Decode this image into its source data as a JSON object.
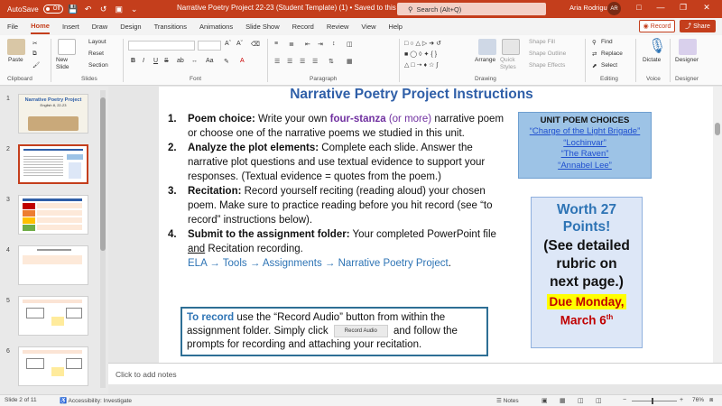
{
  "titlebar": {
    "autosave_label": "AutoSave",
    "autosave_state": "Off",
    "doc_title": "Narrative Poetry Project 22-23 (Student Template) (1) • Saved to this PC",
    "search_placeholder": "Search (Alt+Q)",
    "user_name": "Aria Rodriguez",
    "user_initials": "AR"
  },
  "ribbon_tabs": [
    "File",
    "Home",
    "Insert",
    "Draw",
    "Design",
    "Transitions",
    "Animations",
    "Slide Show",
    "Record",
    "Review",
    "View",
    "Help"
  ],
  "ribbon_actions": {
    "record": "Record",
    "share": "Share"
  },
  "ribbon": {
    "clipboard": {
      "paste": "Paste",
      "label": "Clipboard"
    },
    "slides": {
      "new_slide": "New Slide",
      "layout": "Layout",
      "reset": "Reset",
      "section": "Section",
      "label": "Slides"
    },
    "font": {
      "label": "Font",
      "bold": "B",
      "italic": "I",
      "underline": "U",
      "strike": "S"
    },
    "paragraph": {
      "label": "Paragraph"
    },
    "drawing": {
      "arrange": "Arrange",
      "quick_styles": "Quick Styles",
      "shape_fill": "Shape Fill",
      "shape_outline": "Shape Outline",
      "shape_effects": "Shape Effects",
      "label": "Drawing"
    },
    "editing": {
      "find": "Find",
      "replace": "Replace",
      "select": "Select",
      "label": "Editing"
    },
    "voice": {
      "dictate": "Dictate",
      "label": "Voice"
    },
    "designer": {
      "designer": "Designer",
      "label": "Designer"
    }
  },
  "thumbnails": {
    "numbers": [
      "1",
      "2",
      "3",
      "4",
      "5",
      "6"
    ],
    "slide1_title": "Narrative Poetry Project",
    "slide1_subtitle": "English 8, 22-23"
  },
  "slide": {
    "title": "Narrative Poetry Project Instructions",
    "items": [
      {
        "num": "1.",
        "label": "Poem choice:",
        "t1": " Write your own ",
        "highlight": "four-stanza",
        "highlight2": " (or more)",
        "t2": " narrative poem or choose one of the narrative poems we studied in this unit."
      },
      {
        "num": "2.",
        "label": "Analyze the plot elements:",
        "text": " Complete each slide. Answer the narrative plot questions and use textual evidence to support your responses. (Textual evidence = quotes from the poem.)"
      },
      {
        "num": "3.",
        "label": "Recitation:",
        "text": " Record yourself reciting (reading aloud) your chosen poem. Make sure to practice reading before you hit record (see “to record” instructions below)."
      },
      {
        "num": "4.",
        "label": "Submit to the assignment folder:",
        "t1": " Your completed PowerPoint file ",
        "and": "and",
        "t2": " Recitation recording.",
        "path": "ELA → Tools → Assignments → Narrative Poetry Project",
        "path_end": "."
      }
    ],
    "record_box": {
      "lead": "To record",
      "t1": " use the “Record Audio” button from within the assignment folder. Simply click ",
      "button": "Record Audio",
      "t2": " and follow the prompts for recording and attaching your recitation."
    },
    "poem_choices": {
      "heading": "UNIT POEM CHOICES",
      "poems": [
        "“Charge of the Light Brigade”",
        "“Lochinvar”",
        "“The Raven”",
        "“Annabel Lee”"
      ]
    },
    "worth": {
      "line1": "Worth 27",
      "line2": "Points!",
      "line3": "(See detailed",
      "line4": "rubric on",
      "line5": "next page.)",
      "due1": "Due Monday,",
      "due2": "March 6",
      "due_sup": "th"
    }
  },
  "notes_placeholder": "Click to add notes",
  "statusbar": {
    "slide_info": "Slide 2 of 11",
    "accessibility": "Accessibility: Investigate",
    "notes": "Notes",
    "zoom": "76%"
  },
  "colors": {
    "accent": "#c43e1c",
    "title_blue": "#2f5fa8",
    "purple": "#7030a0",
    "link_blue": "#1f4fcf",
    "due_red": "#c00000",
    "due_highlight": "#ffff00"
  }
}
